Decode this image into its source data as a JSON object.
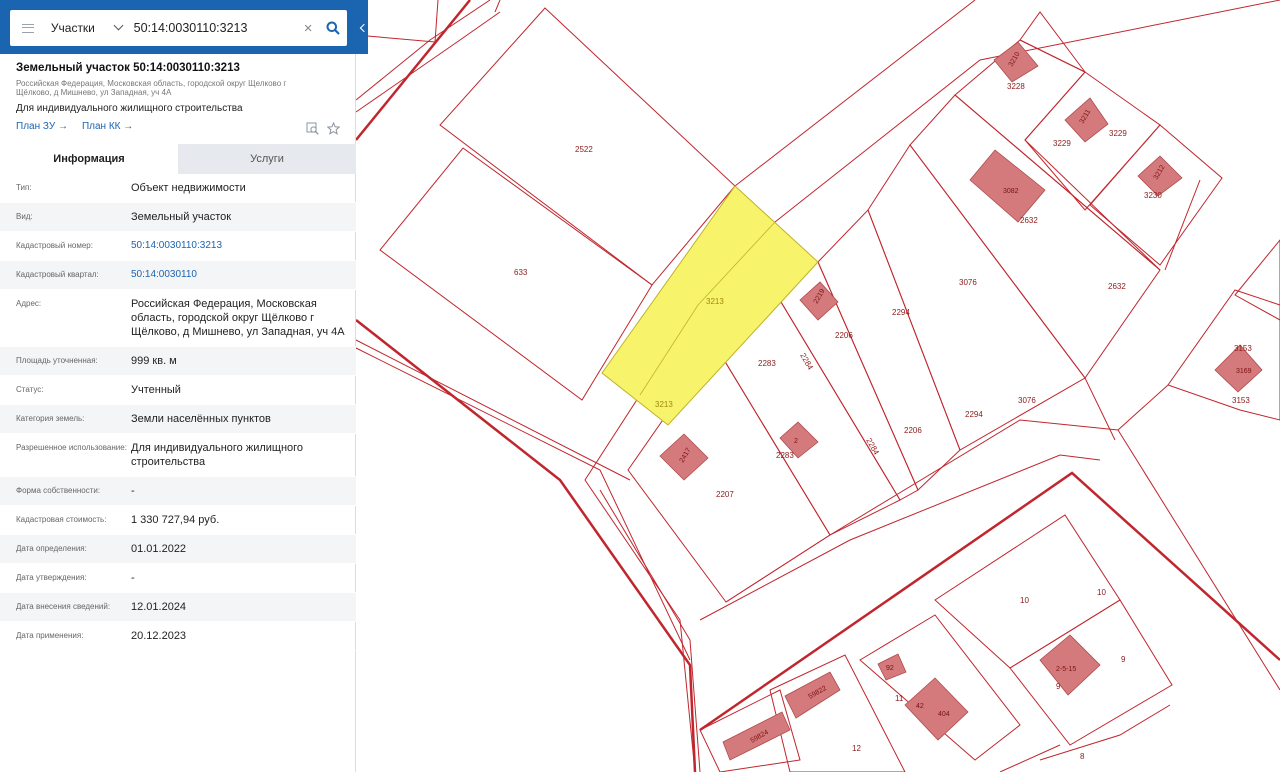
{
  "search": {
    "layer": "Участки",
    "query": "50:14:0030110:3213"
  },
  "header": {
    "title": "Земельный участок 50:14:0030110:3213",
    "address": "Российская Федерация, Московская область, городской округ Щелково г Щёлково, д Мишнево, ул Западная, уч 4А",
    "purpose": "Для индивидуального жилищного строительства",
    "plan_zu": "План ЗУ →",
    "plan_kk": "План КК →"
  },
  "tabs": [
    {
      "label": "Информация",
      "active": true
    },
    {
      "label": "Услуги",
      "active": false
    }
  ],
  "info_rows": [
    {
      "key": "Тип:",
      "value": "Объект недвижимости"
    },
    {
      "key": "Вид:",
      "value": "Земельный участок"
    },
    {
      "key": "Кадастровый номер:",
      "value": "50:14:0030110:3213"
    },
    {
      "key": "Кадастровый квартал:",
      "value": "50:14:0030110"
    },
    {
      "key": "Адрес:",
      "value": "Российская Федерация, Московская область, городской округ Щёлково г Щёлково, д Мишнево, ул Западная, уч 4А"
    },
    {
      "key": "Площадь уточненная:",
      "value": "999 кв. м"
    },
    {
      "key": "Статус:",
      "value": "Учтенный"
    },
    {
      "key": "Категория земель:",
      "value": "Земли населённых пунктов"
    },
    {
      "key": "Разрешенное использование:",
      "value": "Для индивидуального жилищного строительства"
    },
    {
      "key": "Форма собственности:",
      "value": "-"
    },
    {
      "key": "Кадастровая стоимость:",
      "value": "1 330 727,94 руб."
    },
    {
      "key": "Дата определения:",
      "value": "01.01.2022"
    },
    {
      "key": "Дата утверждения:",
      "value": "-"
    },
    {
      "key": "Дата внесения сведений:",
      "value": "12.01.2024"
    },
    {
      "key": "Дата применения:",
      "value": "20.12.2023"
    }
  ],
  "map": {
    "parcel_labels": [
      "2522",
      "633",
      "3213",
      "3213",
      "2283",
      "2283",
      "2284",
      "2284",
      "2206",
      "2206",
      "2294",
      "2294",
      "3076",
      "3076",
      "2632",
      "2632",
      "3228",
      "3229",
      "3229",
      "3230",
      "3153",
      "3153",
      "2207",
      "10",
      "10",
      "9",
      "9",
      "11",
      "12",
      "8"
    ],
    "building_labels": [
      "3210",
      "3211",
      "3082",
      "3212",
      "2219",
      "2417",
      "2",
      "3169",
      "2-5-15",
      "92",
      "42",
      "404",
      "59822",
      "59824"
    ],
    "colors": {
      "boundary": "#c0262d",
      "highlight": "#f7f36b",
      "building": "#d47a7c"
    }
  }
}
